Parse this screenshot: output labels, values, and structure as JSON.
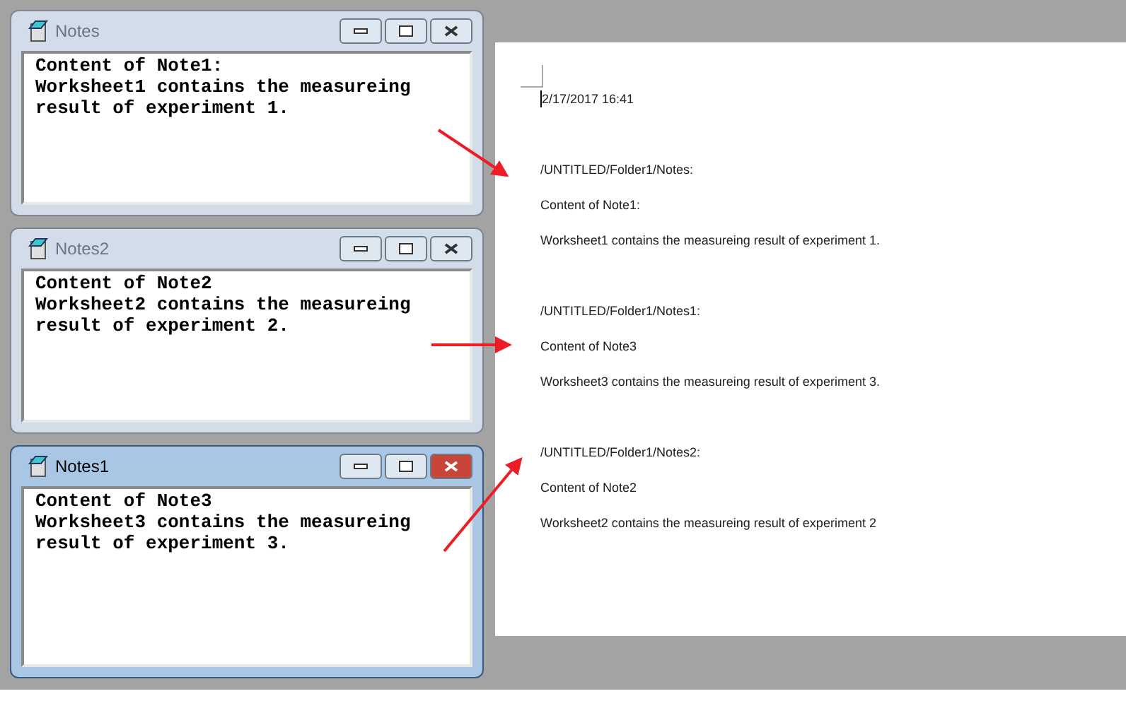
{
  "windows": [
    {
      "title": "Notes",
      "active": false,
      "lines": [
        "Content of Note1:",
        "Worksheet1 contains the measureing",
        "result of experiment 1."
      ]
    },
    {
      "title": "Notes2",
      "active": false,
      "lines": [
        "Content of Note2",
        "Worksheet2 contains the measureing",
        "result of experiment 2."
      ]
    },
    {
      "title": "Notes1",
      "active": true,
      "lines": [
        "Content of Note3",
        "Worksheet3 contains the measureing",
        "result of experiment 3."
      ]
    }
  ],
  "document": {
    "timestamp": "2/17/2017 16:41",
    "sections": [
      {
        "path": "/UNTITLED/Folder1/Notes:",
        "lines": [
          "Content of Note1:",
          "Worksheet1 contains the measureing result of experiment 1."
        ]
      },
      {
        "path": "/UNTITLED/Folder1/Notes1:",
        "lines": [
          "Content of Note3",
          "Worksheet3 contains the measureing result of experiment 3."
        ]
      },
      {
        "path": "/UNTITLED/Folder1/Notes2:",
        "lines": [
          "Content of Note2",
          "Worksheet2 contains the measureing result of experiment 2"
        ]
      }
    ]
  }
}
